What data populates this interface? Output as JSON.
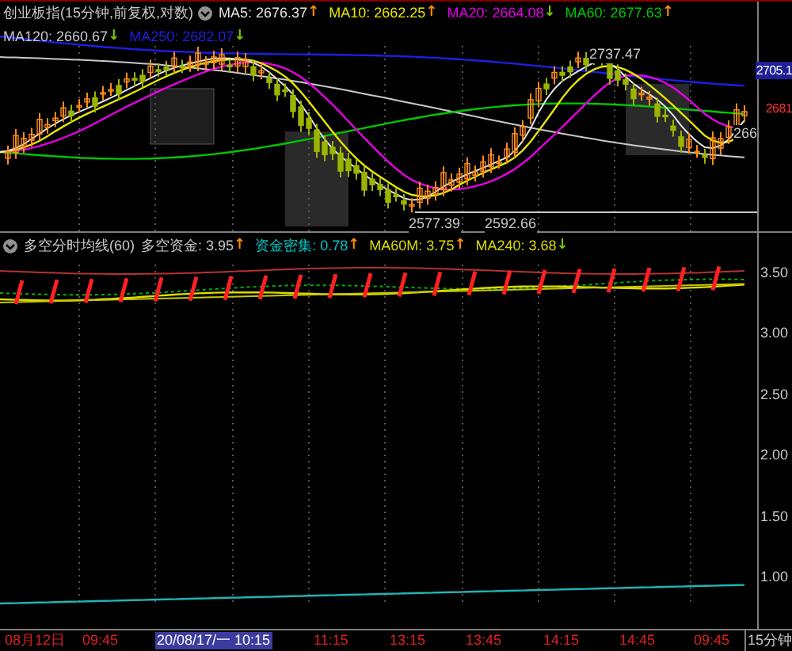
{
  "main_chart": {
    "title": "创业板指(15分钟,前复权,对数)",
    "indicators": [
      {
        "label": "MA5: 2676.37",
        "arrow": {
          "text": "↑",
          "color": "#ff8c00"
        },
        "color": "#e6e6e6"
      },
      {
        "label": "MA10: 2662.25",
        "arrow": {
          "text": "↑",
          "color": "#ff8c00"
        },
        "color": "#e6e600"
      },
      {
        "label": "MA20: 2664.08",
        "arrow": {
          "text": "↓",
          "color": "#7ac800"
        },
        "color": "#e600e6"
      },
      {
        "label": "MA60: 2677.63",
        "arrow": {
          "text": "↑",
          "color": "#ff8c00"
        },
        "color": "#00c800"
      },
      {
        "label": "MA120: 2660.67",
        "arrow": {
          "text": "↓",
          "color": "#7ac800"
        },
        "color": "#c8c8c8"
      },
      {
        "label": "MA250: 2682.07",
        "arrow": {
          "text": "↓",
          "color": "#7ac800"
        },
        "color": "#1e1ee6"
      }
    ],
    "annotations": [
      {
        "text": "2737.47"
      },
      {
        "text": "2577.39"
      },
      {
        "text": "2592.66"
      },
      {
        "text": "266"
      }
    ],
    "axis_labels": [
      {
        "text": "2705.1",
        "highlighted": true
      },
      {
        "text": "2681",
        "highlighted": false
      }
    ]
  },
  "indicator_chart": {
    "title": "多空分时均线(60)",
    "indicators": [
      {
        "label": "多空资金: 3.95",
        "arrow": {
          "text": "↑",
          "color": "#ff8c00"
        },
        "color": "#c8c8c8"
      },
      {
        "label": "资金密集: 0.78",
        "arrow": {
          "text": "↑",
          "color": "#ff8c00"
        },
        "color": "#00c8c8"
      },
      {
        "label": "MA60M: 3.75",
        "arrow": {
          "text": "↑",
          "color": "#ff8c00"
        },
        "color": "#dcdc00"
      },
      {
        "label": "MA240: 3.68",
        "arrow": {
          "text": "↓",
          "color": "#7ac800"
        },
        "color": "#dcdc00"
      }
    ],
    "axis_labels": [
      "3.50",
      "3.00",
      "2.50",
      "2.00",
      "1.50",
      "1.00"
    ]
  },
  "time_axis": {
    "labels": [
      {
        "text": "08月12日",
        "selected": false
      },
      {
        "text": "09:45",
        "selected": false
      },
      {
        "text": "20/08/17/一 10:15",
        "selected": true
      },
      {
        "text": "11:15",
        "selected": false
      },
      {
        "text": "13:15",
        "selected": false
      },
      {
        "text": "13:45",
        "selected": false
      },
      {
        "text": "14:15",
        "selected": false
      },
      {
        "text": "14:45",
        "selected": false
      },
      {
        "text": "09:45",
        "selected": false
      }
    ],
    "period": "15分钟"
  }
}
